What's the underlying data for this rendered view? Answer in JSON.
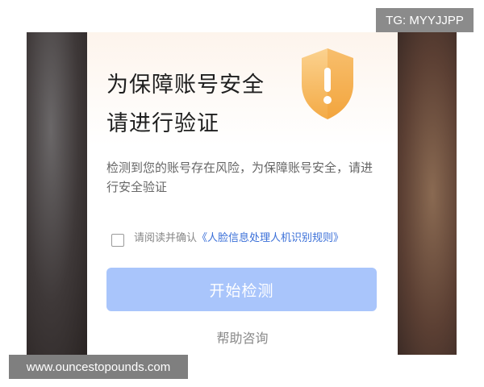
{
  "overlay": {
    "tag": "TG: MYYJJPP",
    "watermark": "www.ouncestopounds.com"
  },
  "dialog": {
    "title_line1": "为保障账号安全",
    "title_line2": "请进行验证",
    "description": "检测到您的账号存在风险，为保障账号安全，请进行安全验证",
    "consent_prefix": "请阅读并确认",
    "consent_link": "《人脸信息处理人机识别规则》",
    "consent_checked": false,
    "start_button": "开始检测",
    "help_link": "帮助咨询",
    "shield_icon": "shield-warning-icon",
    "colors": {
      "button_bg": "#a9c5fb",
      "link": "#3a6fd8",
      "shield": "#f6b24a"
    }
  }
}
